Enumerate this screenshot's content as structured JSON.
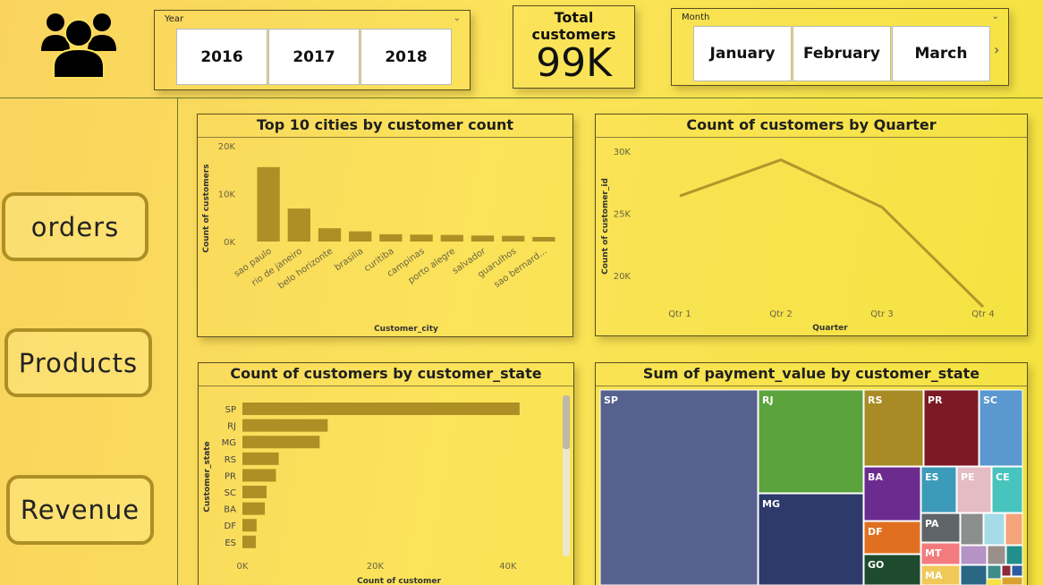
{
  "header": {
    "people_icon": "users-group-icon",
    "year_slicer": {
      "title": "Year",
      "options": [
        "2016",
        "2017",
        "2018"
      ]
    },
    "kpi": {
      "label": "Total customers",
      "value": "99K"
    },
    "month_slicer": {
      "title": "Month",
      "options": [
        "January",
        "February",
        "March"
      ]
    }
  },
  "nav": {
    "orders": "orders",
    "products": "Products",
    "revenue": "Revenue"
  },
  "colors": {
    "bar": "#ad8f25",
    "line": "#b3962a"
  },
  "chart_data": [
    {
      "type": "bar",
      "title": "Top 10 cities by customer count",
      "xlabel": "Customer_city",
      "ylabel": "Count of customers",
      "categories": [
        "sao paulo",
        "rio de janeiro",
        "belo horizonte",
        "brasilia",
        "curitiba",
        "campinas",
        "porto alegre",
        "salvador",
        "guarulhos",
        "sao bernard..."
      ],
      "values": [
        15540,
        6880,
        2770,
        2130,
        1520,
        1440,
        1380,
        1250,
        1190,
        940
      ],
      "yticks": [
        "0K",
        "10K",
        "20K"
      ],
      "ylim": [
        0,
        20000
      ],
      "grid": false
    },
    {
      "type": "line",
      "title": "Count of customers by Quarter",
      "xlabel": "Quarter",
      "ylabel": "Count of customer_id",
      "categories": [
        "Qtr 1",
        "Qtr 2",
        "Qtr 3",
        "Qtr 4"
      ],
      "values": [
        26400,
        29300,
        25500,
        17500
      ],
      "yticks": [
        "20K",
        "25K",
        "30K"
      ],
      "ylim": [
        17500,
        30500
      ],
      "grid": false
    },
    {
      "type": "bar",
      "orientation": "horizontal",
      "title": "Count of customers by customer_state",
      "xlabel": "Count of customer",
      "ylabel": "Customer_state",
      "categories": [
        "SP",
        "RJ",
        "MG",
        "RS",
        "PR",
        "SC",
        "BA",
        "DF",
        "ES"
      ],
      "values": [
        41750,
        12850,
        11630,
        5470,
        5050,
        3640,
        3380,
        2140,
        2030
      ],
      "xticks": [
        "0K",
        "20K",
        "40K"
      ],
      "xlim": [
        0,
        45000
      ],
      "grid": false
    },
    {
      "type": "treemap",
      "title": "Sum of payment_value by customer_state",
      "items": [
        {
          "label": "SP",
          "color": "#57618f"
        },
        {
          "label": "RJ",
          "color": "#5ba33c"
        },
        {
          "label": "MG",
          "color": "#2e3a6a"
        },
        {
          "label": "RS",
          "color": "#a88b24"
        },
        {
          "label": "PR",
          "color": "#7b1a24"
        },
        {
          "label": "SC",
          "color": "#5b98cf"
        },
        {
          "label": "BA",
          "color": "#6c2c8f"
        },
        {
          "label": "ES",
          "color": "#3c9bb8"
        },
        {
          "label": "PE",
          "color": "#e4bcc4"
        },
        {
          "label": "CE",
          "color": "#48c4be"
        },
        {
          "label": "DF",
          "color": "#e07020"
        },
        {
          "label": "PA",
          "color": "#5e6467"
        },
        {
          "label": "GO",
          "color": "#1e4a2e"
        },
        {
          "label": "MT",
          "color": "#f37b7e"
        },
        {
          "label": "MA",
          "color": "#f1c85a"
        },
        {
          "label": "",
          "color": "#8a8e8c"
        },
        {
          "label": "",
          "color": "#a6dbe8"
        },
        {
          "label": "",
          "color": "#f4a37a"
        },
        {
          "label": "",
          "color": "#b693c6"
        },
        {
          "label": "",
          "color": "#9a8f8a"
        },
        {
          "label": "",
          "color": "#238f8a"
        },
        {
          "label": "",
          "color": "#2a6785"
        },
        {
          "label": "",
          "color": "#3c8c8a"
        },
        {
          "label": "",
          "color": "#8a2a3a"
        },
        {
          "label": "",
          "color": "#2c5ca0"
        },
        {
          "label": "",
          "color": "#d8a230"
        }
      ]
    }
  ]
}
